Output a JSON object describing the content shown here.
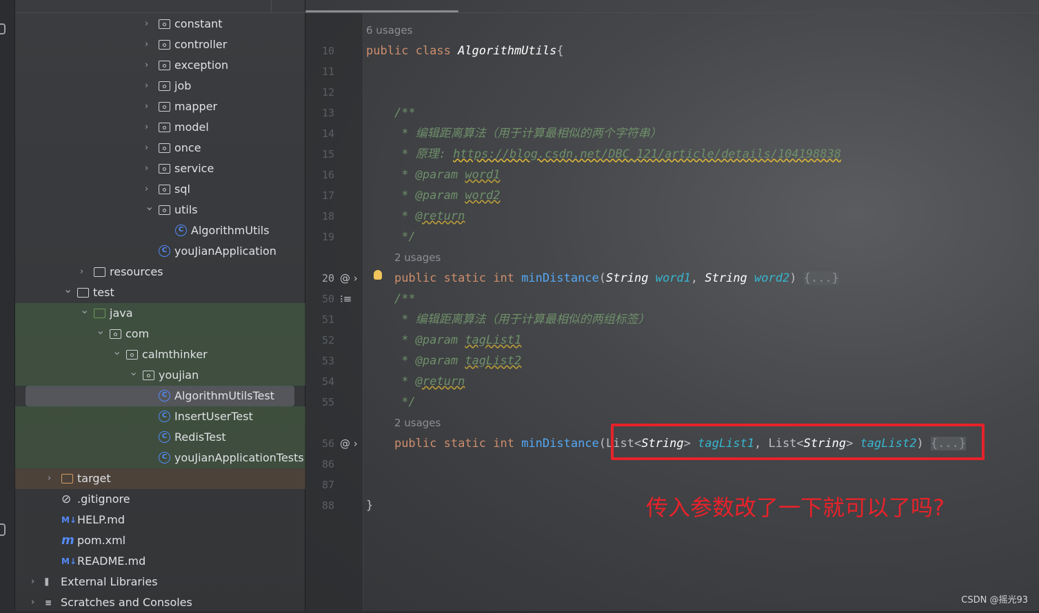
{
  "project_tree": [
    {
      "label": "constant",
      "type": "package",
      "depth": 7,
      "arrow": "collapsed"
    },
    {
      "label": "controller",
      "type": "package",
      "depth": 7,
      "arrow": "collapsed"
    },
    {
      "label": "exception",
      "type": "package",
      "depth": 7,
      "arrow": "collapsed"
    },
    {
      "label": "job",
      "type": "package",
      "depth": 7,
      "arrow": "collapsed"
    },
    {
      "label": "mapper",
      "type": "package",
      "depth": 7,
      "arrow": "collapsed"
    },
    {
      "label": "model",
      "type": "package",
      "depth": 7,
      "arrow": "collapsed"
    },
    {
      "label": "once",
      "type": "package",
      "depth": 7,
      "arrow": "collapsed"
    },
    {
      "label": "service",
      "type": "package",
      "depth": 7,
      "arrow": "collapsed"
    },
    {
      "label": "sql",
      "type": "package",
      "depth": 7,
      "arrow": "collapsed"
    },
    {
      "label": "utils",
      "type": "package",
      "depth": 7,
      "arrow": "expanded"
    },
    {
      "label": "AlgorithmUtils",
      "type": "class",
      "depth": 8
    },
    {
      "label": "youJianApplication",
      "type": "class",
      "depth": 7
    },
    {
      "label": "resources",
      "type": "folder",
      "depth": 3,
      "arrow": "collapsed"
    },
    {
      "label": "test",
      "type": "folder",
      "depth": 2,
      "arrow": "expanded"
    },
    {
      "label": "java",
      "type": "folder-green",
      "depth": 3,
      "arrow": "expanded",
      "bg": "test"
    },
    {
      "label": "com",
      "type": "package",
      "depth": 4,
      "arrow": "expanded",
      "bg": "test"
    },
    {
      "label": "calmthinker",
      "type": "package",
      "depth": 5,
      "arrow": "expanded",
      "bg": "test"
    },
    {
      "label": "youjian",
      "type": "package",
      "depth": 6,
      "arrow": "expanded",
      "bg": "test"
    },
    {
      "label": "AlgorithmUtilsTest",
      "type": "class",
      "depth": 7,
      "bg": "test",
      "selected": true
    },
    {
      "label": "InsertUserTest",
      "type": "class",
      "depth": 7,
      "bg": "test"
    },
    {
      "label": "RedisTest",
      "type": "class",
      "depth": 7,
      "bg": "test"
    },
    {
      "label": "youJianApplicationTests",
      "type": "class",
      "depth": 7,
      "bg": "test"
    },
    {
      "label": "target",
      "type": "folder-orange",
      "depth": 1,
      "arrow": "collapsed",
      "bg": "excl"
    },
    {
      "label": ".gitignore",
      "type": "gitignore",
      "depth": 1
    },
    {
      "label": "HELP.md",
      "type": "markdown",
      "depth": 1
    },
    {
      "label": "pom.xml",
      "type": "maven",
      "depth": 1
    },
    {
      "label": "README.md",
      "type": "markdown",
      "depth": 1
    },
    {
      "label": "External Libraries",
      "type": "libraries",
      "depth": 0,
      "arrow": "collapsed"
    },
    {
      "label": "Scratches and Consoles",
      "type": "scratches",
      "depth": 0,
      "arrow": "collapsed"
    }
  ],
  "editor": {
    "lines": [
      {
        "ln": "",
        "tokens": [
          [
            "hint",
            "6 usages"
          ]
        ]
      },
      {
        "ln": "10",
        "tokens": [
          [
            "kw",
            "public class "
          ],
          [
            "it",
            "AlgorithmUtils"
          ],
          [
            "",
            "{"
          ]
        ]
      },
      {
        "ln": "11",
        "tokens": []
      },
      {
        "ln": "12",
        "tokens": []
      },
      {
        "ln": "13",
        "tokens": [
          [
            "",
            "    "
          ],
          [
            "cm",
            "/**"
          ]
        ]
      },
      {
        "ln": "14",
        "tokens": [
          [
            "",
            "    "
          ],
          [
            "cm",
            " * 编辑距离算法（用于计算最相似的两个字符串）"
          ]
        ]
      },
      {
        "ln": "15",
        "tokens": [
          [
            "",
            "    "
          ],
          [
            "cm",
            " * 原理: "
          ],
          [
            "link",
            "https://blog.csdn.net/DBC_121/article/details/104198838"
          ]
        ]
      },
      {
        "ln": "16",
        "tokens": [
          [
            "",
            "    "
          ],
          [
            "cm",
            " * @param "
          ],
          [
            "tag",
            "word1"
          ]
        ]
      },
      {
        "ln": "17",
        "tokens": [
          [
            "",
            "    "
          ],
          [
            "cm",
            " * @param "
          ],
          [
            "tag",
            "word2"
          ]
        ]
      },
      {
        "ln": "18",
        "tokens": [
          [
            "",
            "    "
          ],
          [
            "cm",
            " * "
          ],
          [
            "tag",
            "@return"
          ]
        ]
      },
      {
        "ln": "19",
        "tokens": [
          [
            "",
            "    "
          ],
          [
            "cm",
            " */"
          ]
        ]
      },
      {
        "ln": "",
        "tokens": [
          [
            "",
            "    "
          ],
          [
            "hint",
            "2 usages"
          ]
        ]
      },
      {
        "ln": "20",
        "bright": true,
        "marks": "@ ›",
        "bulb": true,
        "tokens": [
          [
            "",
            "    "
          ],
          [
            "kw",
            "public static int "
          ],
          [
            "fn",
            "minDistance"
          ],
          [
            "",
            "("
          ],
          [
            "it",
            "String"
          ],
          [
            "",
            " "
          ],
          [
            "par",
            "word1"
          ],
          [
            "",
            ", "
          ],
          [
            "it",
            "String"
          ],
          [
            "",
            " "
          ],
          [
            "par",
            "word2"
          ],
          [
            "",
            ") "
          ],
          [
            "fold",
            "{...}"
          ]
        ]
      },
      {
        "ln": "50",
        "marks": "⁝≡",
        "tokens": [
          [
            "",
            "    "
          ],
          [
            "cm",
            "/**"
          ]
        ]
      },
      {
        "ln": "51",
        "tokens": [
          [
            "",
            "    "
          ],
          [
            "cm",
            " * 编辑距离算法（用于计算最相似的两组标签）"
          ]
        ]
      },
      {
        "ln": "52",
        "tokens": [
          [
            "",
            "    "
          ],
          [
            "cm",
            " * @param "
          ],
          [
            "tag",
            "tagList1"
          ]
        ]
      },
      {
        "ln": "53",
        "tokens": [
          [
            "",
            "    "
          ],
          [
            "cm",
            " * @param "
          ],
          [
            "tag",
            "tagList2"
          ]
        ]
      },
      {
        "ln": "54",
        "tokens": [
          [
            "",
            "    "
          ],
          [
            "cm",
            " * "
          ],
          [
            "tag",
            "@return"
          ]
        ]
      },
      {
        "ln": "55",
        "tokens": [
          [
            "",
            "    "
          ],
          [
            "cm",
            " */"
          ]
        ]
      },
      {
        "ln": "",
        "tokens": [
          [
            "",
            "    "
          ],
          [
            "hint",
            "2 usages"
          ]
        ]
      },
      {
        "ln": "56",
        "marks": "@ ›",
        "tokens": [
          [
            "",
            "    "
          ],
          [
            "kw",
            "public static int "
          ],
          [
            "fn",
            "minDistance"
          ],
          [
            "",
            "(List<"
          ],
          [
            "it",
            "String"
          ],
          [
            "",
            "> "
          ],
          [
            "par",
            "tagList1"
          ],
          [
            "",
            ", List<"
          ],
          [
            "it",
            "String"
          ],
          [
            "",
            "> "
          ],
          [
            "par",
            "tagList2"
          ],
          [
            "",
            ") "
          ],
          [
            "fold",
            "{...}"
          ]
        ]
      },
      {
        "ln": "86",
        "tokens": []
      },
      {
        "ln": "87",
        "tokens": []
      },
      {
        "ln": "88",
        "tokens": [
          [
            "",
            "}"
          ]
        ]
      }
    ]
  },
  "annotation": {
    "text": "传入参数改了一下就可以了吗?",
    "color": "#e8222a"
  },
  "watermark": "CSDN @摇光93"
}
